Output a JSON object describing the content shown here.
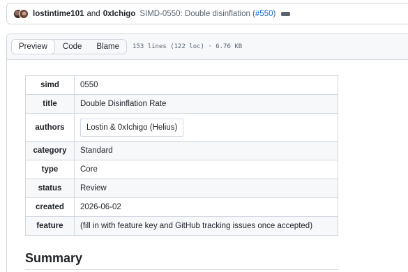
{
  "commit": {
    "author1": "lostintime101",
    "and_text": "and",
    "author2": "0xIchigo",
    "message": "SIMD-0550: Double disinflation (",
    "pr_link": "#550",
    "message_close": ")"
  },
  "file_header": {
    "tabs": [
      "Preview",
      "Code",
      "Blame"
    ],
    "active_tab": "Preview",
    "meta": "153 lines (122 loc) · 6.76 KB"
  },
  "metadata": {
    "rows": [
      {
        "key": "simd",
        "value": "0550"
      },
      {
        "key": "title",
        "value": "Double Disinflation Rate"
      },
      {
        "key": "authors",
        "value": "Lostin & 0xIchigo (Helius)"
      },
      {
        "key": "category",
        "value": "Standard"
      },
      {
        "key": "type",
        "value": "Core"
      },
      {
        "key": "status",
        "value": "Review"
      },
      {
        "key": "created",
        "value": "2026-06-02"
      },
      {
        "key": "feature",
        "value": "(fill in with feature key and GitHub tracking issues once accepted)"
      }
    ]
  },
  "summary": {
    "heading": "Summary"
  },
  "icons": {
    "avatars": "user-avatar",
    "more": "kebab-horizontal-icon"
  }
}
